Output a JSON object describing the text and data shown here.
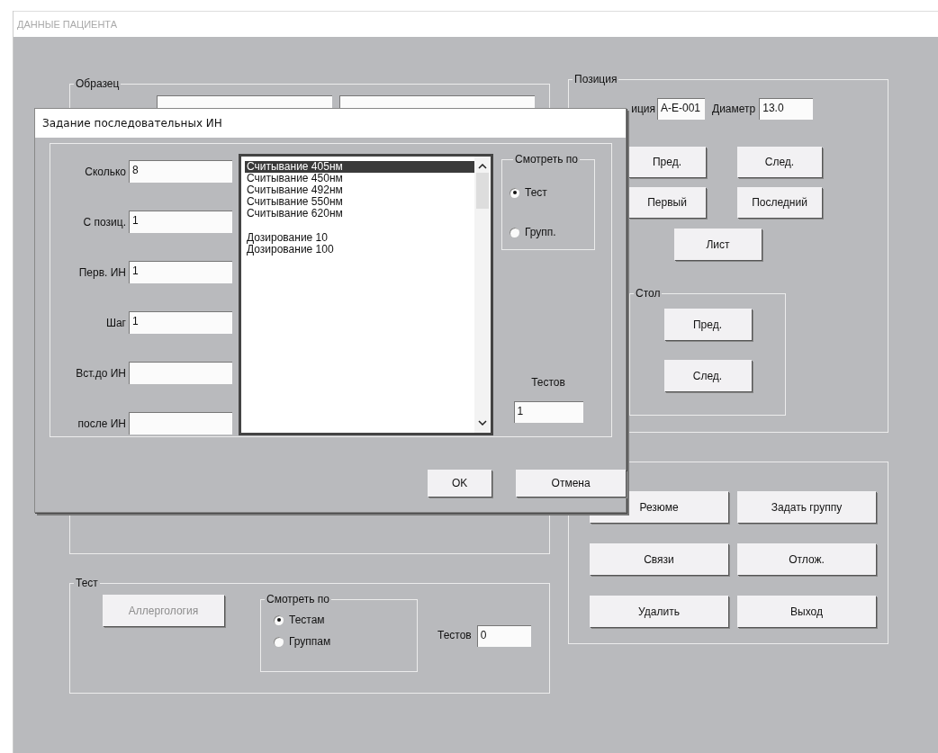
{
  "window": {
    "title": "ДАННЫЕ ПАЦИЕНТА"
  },
  "sample": {
    "title": "Образец"
  },
  "position": {
    "title": "Позиция",
    "position_label": "иция",
    "position_value": "A-E-001",
    "diameter_label": "Диаметр",
    "diameter_value": "13.0",
    "buttons": [
      "Пред.",
      "След.",
      "Первый",
      "Последний"
    ],
    "sheet_button": "Лист",
    "table": {
      "title": "Стол",
      "buttons": [
        "Пред.",
        "След."
      ]
    }
  },
  "actions": {
    "buttons": [
      "Резюме",
      "Задать группу",
      "Связи",
      "Отлож.",
      "Удалить",
      "Выход"
    ]
  },
  "test": {
    "title": "Тест",
    "button": {
      "label": "Аллергология",
      "disabled": true
    },
    "view": {
      "title": "Смотреть по",
      "options": [
        {
          "label": "Тестам",
          "selected": true
        },
        {
          "label": "Группам",
          "selected": false
        }
      ]
    },
    "count_label": "Тестов",
    "count_value": "0"
  },
  "dialog": {
    "title": "Задание последовательных ИН",
    "fields": [
      {
        "label": "Сколько",
        "value": "8"
      },
      {
        "label": "С позиц.",
        "value": "1"
      },
      {
        "label": "Перв. ИН",
        "value": "1"
      },
      {
        "label": "Шаг",
        "value": "1"
      },
      {
        "label": "Вст.до ИН"
      },
      {
        "label": "после ИН"
      }
    ],
    "list": {
      "groups": [
        {
          "items": [
            {
              "text": "Считывание 405нм",
              "selected": true
            },
            {
              "text": "Считывание 450нм",
              "selected": false
            },
            {
              "text": "Считывание 492нм",
              "selected": false
            },
            {
              "text": "Считывание 550нм",
              "selected": false
            },
            {
              "text": "Считывание 620нм",
              "selected": false
            }
          ]
        },
        {
          "items": [
            {
              "text": "Дозирование 10",
              "selected": false
            },
            {
              "text": "Дозирование 100",
              "selected": false
            }
          ]
        }
      ]
    },
    "view": {
      "title": "Смотреть по",
      "options": [
        {
          "label": "Тест",
          "selected": true
        },
        {
          "label": "Групп.",
          "selected": false
        }
      ]
    },
    "count_label": "Тестов",
    "count_value": "1",
    "buttons": [
      "OK",
      "Отмена"
    ]
  }
}
